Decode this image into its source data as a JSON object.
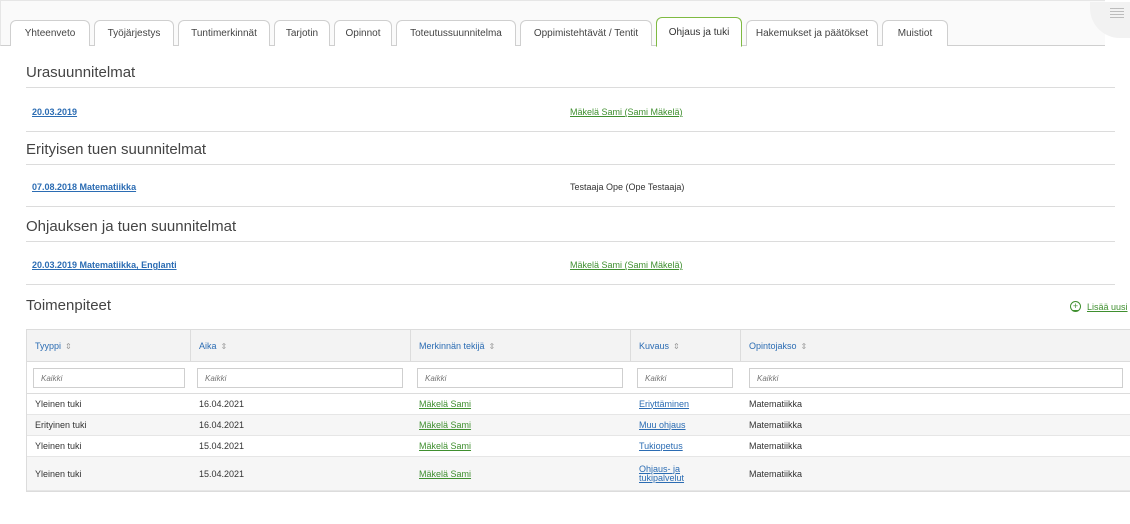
{
  "tabs": [
    {
      "label": "Yhteenveto",
      "active": false
    },
    {
      "label": "Työjärjestys",
      "active": false
    },
    {
      "label": "Tuntimerkinnät",
      "active": false
    },
    {
      "label": "Tarjotin",
      "active": false
    },
    {
      "label": "Opinnot",
      "active": false
    },
    {
      "label": "Toteutussuunnitelma",
      "active": false
    },
    {
      "label": "Oppimistehtävät / Tentit",
      "active": false
    },
    {
      "label": "Ohjaus ja tuki",
      "active": true
    },
    {
      "label": "Hakemukset ja päätökset",
      "active": false
    },
    {
      "label": "Muistiot",
      "active": false
    }
  ],
  "career_plans": {
    "heading": "Urasuunnitelmat",
    "date_link": "20.03.2019",
    "person": "Mäkelä Sami (Sami Mäkelä)"
  },
  "special_support": {
    "heading": "Erityisen tuen suunnitelmat",
    "date_link": "07.08.2018 Matematiikka",
    "person": "Testaaja Ope (Ope Testaaja)"
  },
  "guidance_support": {
    "heading": "Ohjauksen ja tuen suunnitelmat",
    "date_link": "20.03.2019 Matematiikka, Englanti",
    "person": "Mäkelä Sami (Sami Mäkelä)"
  },
  "measures": {
    "heading": "Toimenpiteet",
    "add_new": "Lisää uusi",
    "columns": [
      "Tyyppi",
      "Aika",
      "Merkinnän tekijä",
      "Kuvaus",
      "Opintojakso"
    ],
    "filter_placeholder": "Kaikki",
    "rows": [
      {
        "type": "Yleinen tuki",
        "time": "16.04.2021",
        "author": "Mäkelä Sami",
        "desc": "Eriyttäminen",
        "course": "Matematiikka"
      },
      {
        "type": "Erityinen tuki",
        "time": "16.04.2021",
        "author": "Mäkelä Sami",
        "desc": "Muu ohjaus",
        "course": "Matematiikka"
      },
      {
        "type": "Yleinen tuki",
        "time": "15.04.2021",
        "author": "Mäkelä Sami",
        "desc": "Tukiopetus",
        "course": "Matematiikka"
      },
      {
        "type": "Yleinen tuki",
        "time": "15.04.2021",
        "author": "Mäkelä Sami",
        "desc": "Ohjaus- ja tukipalvelut",
        "course": "Matematiikka"
      }
    ]
  },
  "colors": {
    "accent_green": "#7fba42",
    "link_blue": "#2b6cb3",
    "link_green": "#3f8f2f"
  }
}
